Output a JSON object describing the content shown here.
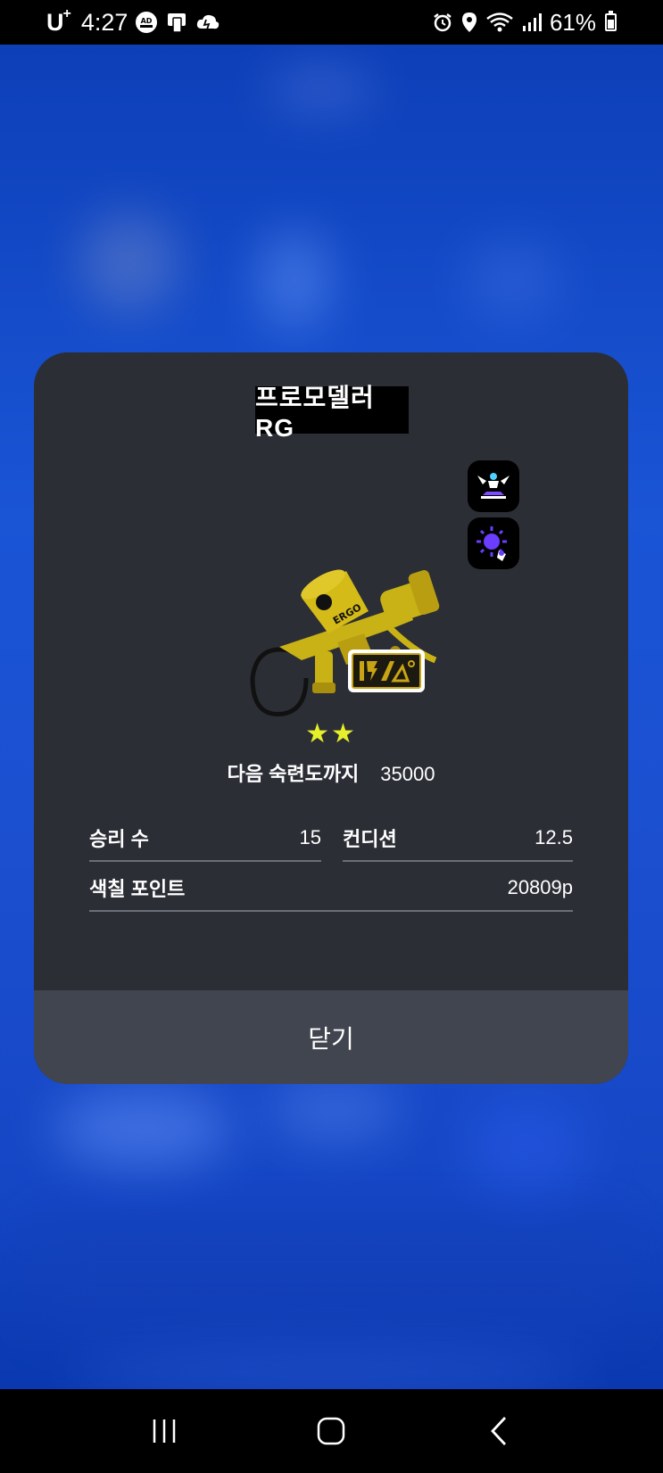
{
  "status_bar": {
    "carrier": "U",
    "carrier_sup": "+",
    "time": "4:27",
    "battery_percent": "61%",
    "battery_level": 0.61,
    "icons": [
      "ad-blocker-icon",
      "phone-clip-icon",
      "cloud-icon",
      "alarm-icon",
      "location-icon",
      "wifi-icon",
      "signal-icon",
      "battery-icon"
    ]
  },
  "dialog": {
    "weapon_name": "프로모델러 RG",
    "stars": "★★",
    "star_count": 2,
    "next_mastery_label": "다음 숙련도까지",
    "next_mastery_value": "35000",
    "stats": {
      "wins_label": "승리 수",
      "wins_value": "15",
      "condition_label": "컨디션",
      "condition_value": "12.5",
      "paint_label": "색칠 포인트",
      "paint_value": "20809p"
    },
    "close_label": "닫기"
  },
  "nav_bar": {
    "icons": [
      "recent-apps-icon",
      "home-icon",
      "back-icon"
    ]
  },
  "colors": {
    "dialog_bg": "#2b2e35",
    "close_bg": "#41454f",
    "star": "#e6f02a",
    "weapon": "#c9b215",
    "background_blue": "#1a55d6"
  }
}
